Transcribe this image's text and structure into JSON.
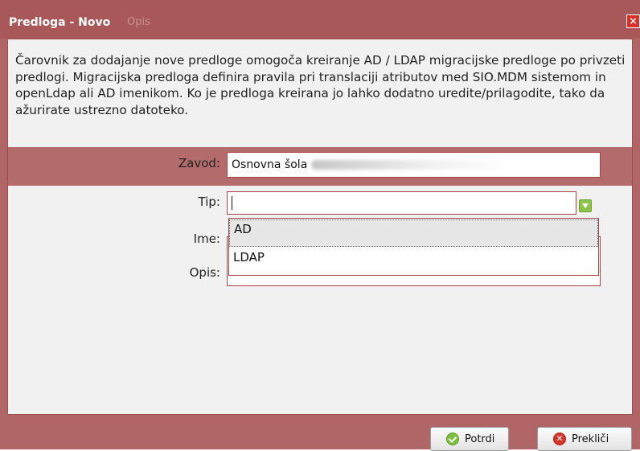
{
  "dialog": {
    "title": "Predloga - Novo",
    "title_ghost_text": "Opis",
    "close_symbol": "×"
  },
  "intro": {
    "text": "Čarovnik za dodajanje nove predloge omogoča kreiranje AD / LDAP migracijske predloge po privzeti predlogi. Migracijska predloga definira pravila pri translaciji atributov med SIO.MDM sistemom in openLdap ali AD imenikom. Ko je predloga kreirana jo lahko dodatno uredite/prilagodite, tako da ažurirate ustrezno datoteko."
  },
  "form": {
    "zavod_label": "Zavod:",
    "zavod_value": "Osnovna šola",
    "tip_label": "Tip:",
    "tip_value": "",
    "ime_label": "Ime:",
    "opis_label": "Opis:"
  },
  "dropdown": {
    "options": [
      "AD",
      "LDAP"
    ],
    "highlighted": "AD"
  },
  "buttons": {
    "confirm_label": "Potrdi",
    "cancel_label": "Prekliči"
  },
  "icons": {
    "close": "close-icon",
    "confirm": "check-circle-icon",
    "cancel": "x-circle-icon",
    "combo_trigger": "chevron-down-icon"
  },
  "colors": {
    "frame": "#b06666",
    "accent_band": "#b46b6b",
    "confirm_icon": "#7ebf3d",
    "cancel_icon": "#d8322b",
    "trigger": "#8cc449"
  }
}
